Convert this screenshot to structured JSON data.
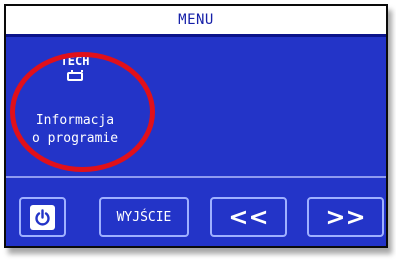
{
  "screen": {
    "title": "MENU",
    "item": {
      "heading": "TECH",
      "icon": "chip-icon",
      "label_line1": "Informacja",
      "label_line2": "o programie"
    }
  },
  "buttons": {
    "power_icon": "power-icon",
    "exit_label": "WYJŚCIE",
    "prev_label": "<<",
    "next_label": ">>"
  },
  "annotation": {
    "highlight": "red-circle"
  },
  "colors": {
    "screen_background": "#2334c8",
    "text": "#ffffff",
    "title_text": "#1620a8",
    "highlight": "#e0101a"
  }
}
